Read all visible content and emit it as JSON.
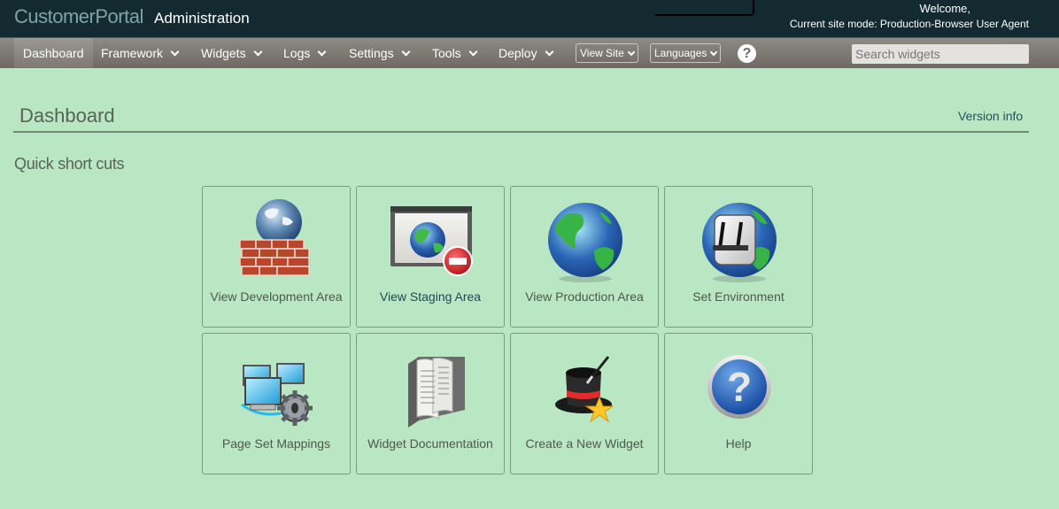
{
  "header": {
    "brand": "CustomerPortal",
    "brand_sub": "Administration",
    "welcome": "Welcome,",
    "site_mode": "Current site mode: Production-Browser User Agent"
  },
  "nav": {
    "items": [
      {
        "label": "Dashboard",
        "icon": null
      },
      {
        "label": "Framework",
        "icon": "chevron-down-icon"
      },
      {
        "label": "Widgets",
        "icon": "chevron-down-icon"
      },
      {
        "label": "Logs",
        "icon": "chevron-down-icon"
      },
      {
        "label": "Settings",
        "icon": "chevron-down-icon"
      },
      {
        "label": "Tools",
        "icon": "chevron-down-icon"
      },
      {
        "label": "Deploy",
        "icon": "chevron-down-icon"
      }
    ],
    "view_site": "View Site",
    "languages": "Languages",
    "help_glyph": "?",
    "search_placeholder": "Search widgets"
  },
  "main": {
    "title": "Dashboard",
    "version_link": "Version info",
    "section_title": "Quick short cuts",
    "tiles": [
      {
        "label": "View Development Area",
        "icon": "globe-firewall-icon"
      },
      {
        "label": "View Staging Area",
        "icon": "browser-globe-blocked-icon"
      },
      {
        "label": "View Production Area",
        "icon": "globe-icon"
      },
      {
        "label": "Set Environment",
        "icon": "globe-switch-icon"
      },
      {
        "label": "Page Set Mappings",
        "icon": "network-computers-gear-icon"
      },
      {
        "label": "Widget Documentation",
        "icon": "open-book-icon"
      },
      {
        "label": "Create a New Widget",
        "icon": "magic-hat-star-icon"
      },
      {
        "label": "Help",
        "icon": "help-question-icon"
      }
    ]
  }
}
